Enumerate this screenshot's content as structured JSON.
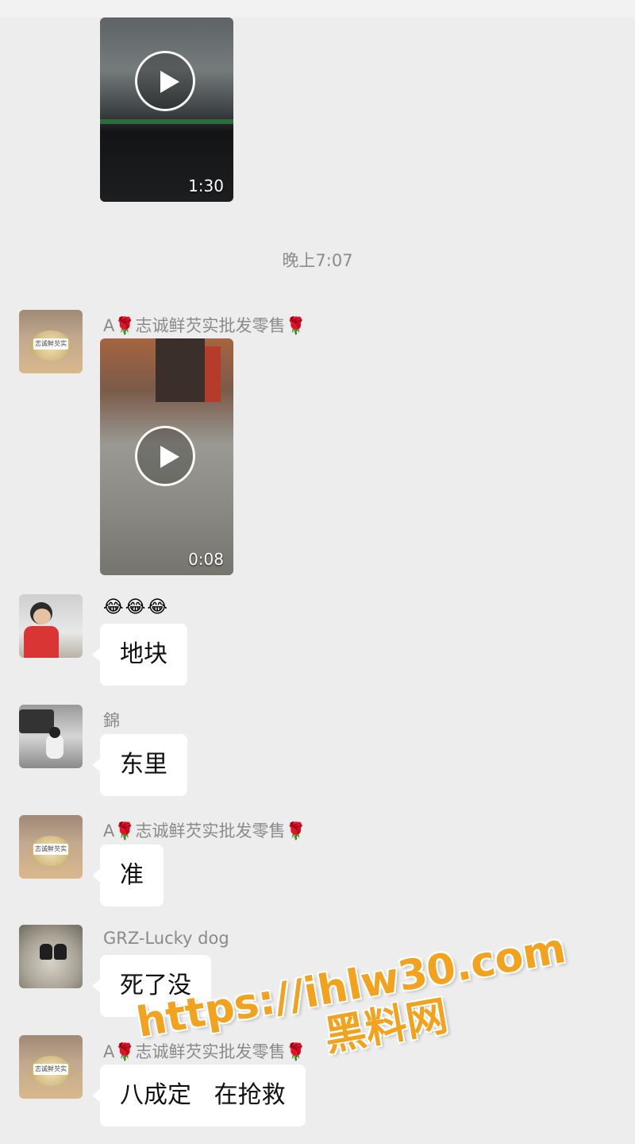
{
  "videos": [
    {
      "duration": "1:30"
    },
    {
      "duration": "0:08"
    }
  ],
  "timestamp": "晚上7:07",
  "messages": [
    {
      "sender": "A🌹志诚鲜芡实批发零售🌹",
      "type": "video"
    },
    {
      "sender": "",
      "emojis": "😂😂😂",
      "text": "地块"
    },
    {
      "sender": "錦",
      "text": "东里"
    },
    {
      "sender": "A🌹志诚鲜芡实批发零售🌹",
      "text": "准"
    },
    {
      "sender": "GRZ-Lucky dog",
      "text": "死了没"
    },
    {
      "sender": "A🌹志诚鲜芡实批发零售🌹",
      "text": "八成定   在抢救"
    }
  ],
  "avatar_label": "志诚鲜芡实",
  "watermark": {
    "line1": "https://ihlw30.com",
    "line2": "黑料网"
  },
  "colors": {
    "background": "#ededed",
    "bubble": "#ffffff",
    "watermark": "#f3a21d"
  }
}
